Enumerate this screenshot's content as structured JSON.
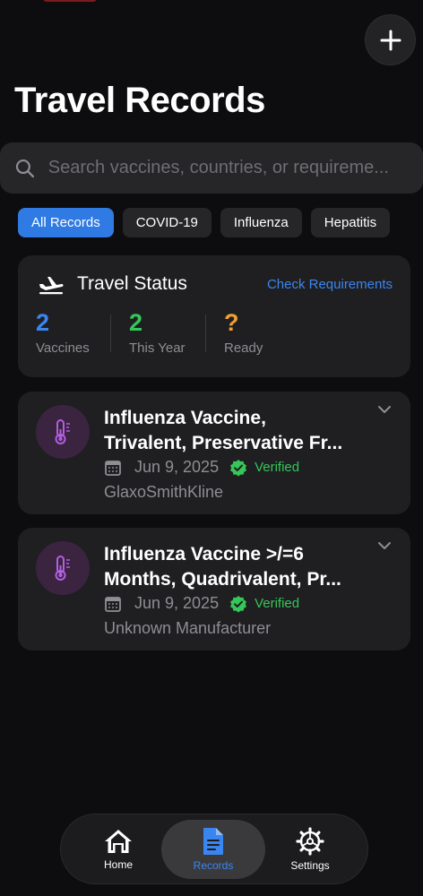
{
  "page": {
    "title": "Travel Records"
  },
  "search": {
    "placeholder": "Search vaccines, countries, or requireme..."
  },
  "filters": [
    {
      "label": "All Records",
      "active": true
    },
    {
      "label": "COVID-19",
      "active": false
    },
    {
      "label": "Influenza",
      "active": false
    },
    {
      "label": "Hepatitis",
      "active": false
    }
  ],
  "travel_status": {
    "title": "Travel Status",
    "link": "Check Requirements",
    "stats": [
      {
        "value": "2",
        "label": "Vaccines",
        "color": "#3a86f0"
      },
      {
        "value": "2",
        "label": "This Year",
        "color": "#34c759"
      },
      {
        "value": "?",
        "label": "Ready",
        "color": "#f0a030"
      }
    ]
  },
  "records": [
    {
      "title_line1": "Influenza Vaccine,",
      "title_line2": "Trivalent, Preservative Fr...",
      "date": "Jun 9, 2025",
      "status": "Verified",
      "manufacturer": "GlaxoSmithKline",
      "icon": "thermometer-icon"
    },
    {
      "title_line1": "Influenza Vaccine >/=6",
      "title_line2": "Months, Quadrivalent, Pr...",
      "date": "Jun 9, 2025",
      "status": "Verified",
      "manufacturer": "Unknown Manufacturer",
      "icon": "thermometer-icon"
    }
  ],
  "tabbar": {
    "tabs": [
      {
        "label": "Home",
        "icon": "house-icon",
        "active": false
      },
      {
        "label": "Records",
        "icon": "document-icon",
        "active": true
      },
      {
        "label": "Settings",
        "icon": "gear-icon",
        "active": false
      }
    ]
  },
  "colors": {
    "accent": "#3a86f0",
    "success": "#34c759",
    "warning": "#f0a030",
    "icon_purple": "#b25fe0"
  }
}
